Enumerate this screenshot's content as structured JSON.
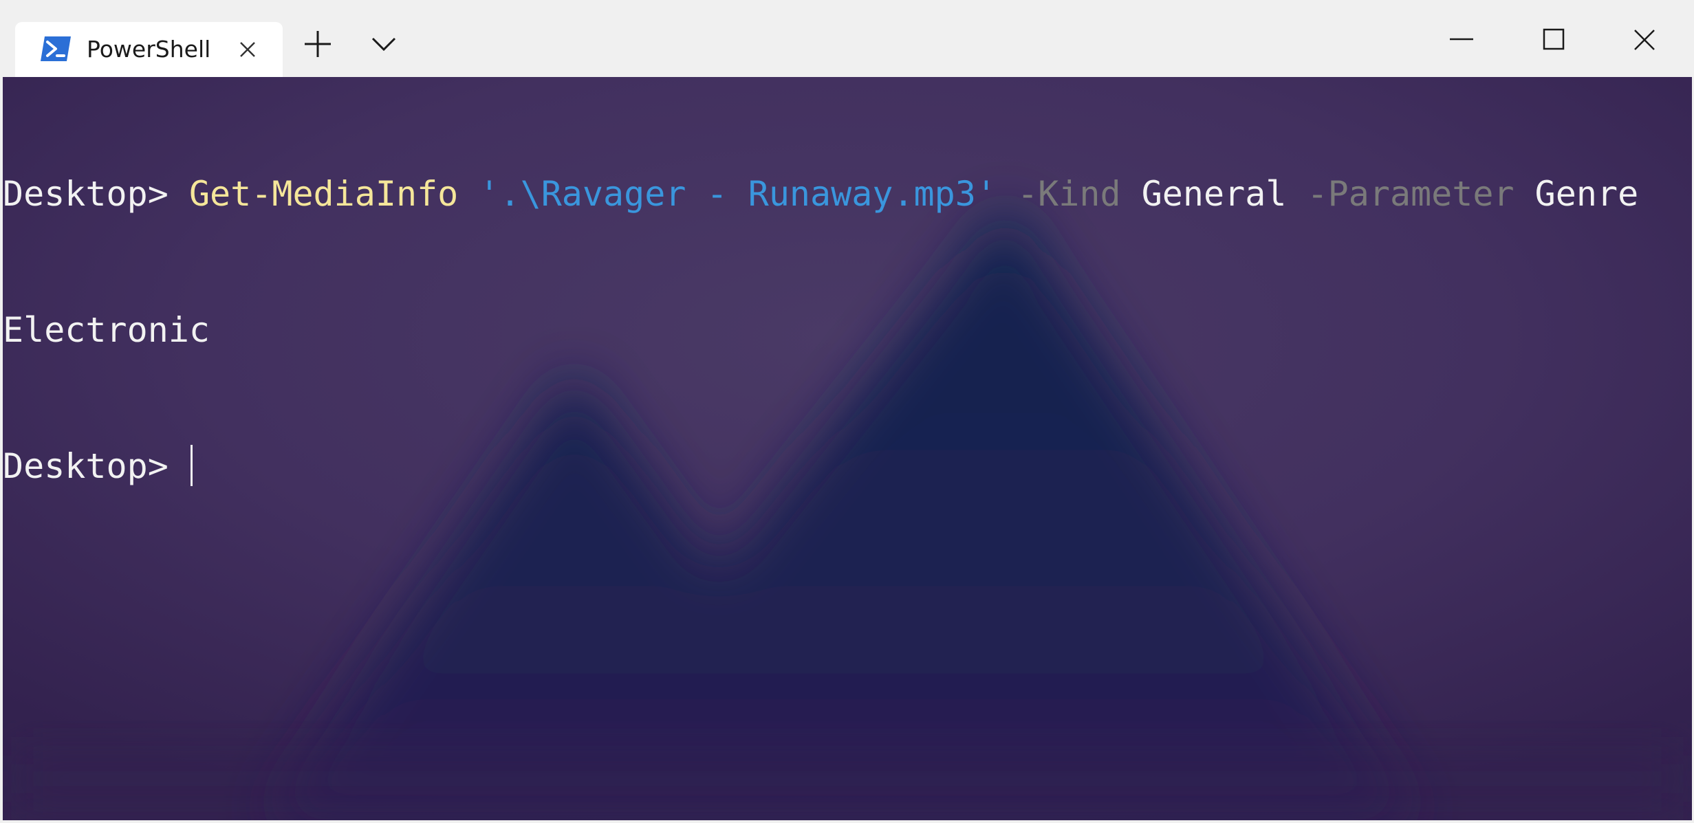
{
  "tab": {
    "title": "PowerShell",
    "icon": "powershell-icon"
  },
  "controls": {
    "new_tab_icon": "plus-icon",
    "dropdown_icon": "chevron-down-icon",
    "minimize_icon": "minimize-icon",
    "maximize_icon": "maximize-icon",
    "close_icon": "close-icon"
  },
  "terminal": {
    "line1": {
      "prompt": "Desktop> ",
      "command": "Get-MediaInfo",
      "space1": " ",
      "path": "'.\\Ravager - Runaway.mp3'",
      "space2": " ",
      "param1": "-Kind",
      "space3": " ",
      "arg1": "General",
      "space4": " ",
      "param2": "-Parameter",
      "space5": " ",
      "arg2": "Genre"
    },
    "line2": {
      "output": "Electronic"
    },
    "line3": {
      "prompt": "Desktop> "
    }
  },
  "colors": {
    "background": "#3d2a5a",
    "command": "#f5e69a",
    "string": "#3a96dd",
    "parameter": "#7a7a7a",
    "text": "#f2f2f2",
    "titlebar": "#f0f0f0",
    "accent_icon": "#2b6fd6"
  }
}
